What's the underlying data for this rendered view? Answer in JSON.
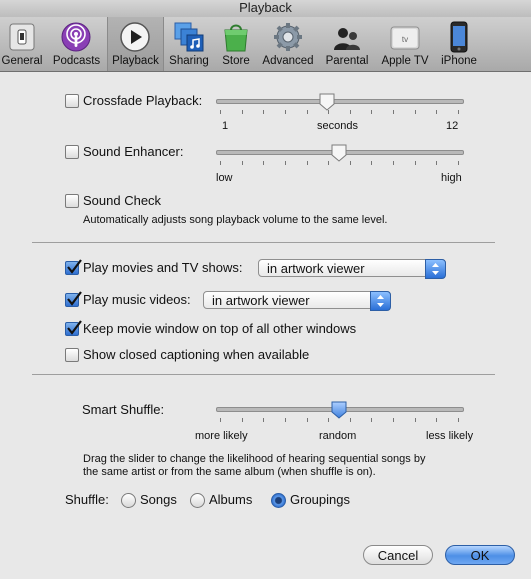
{
  "window": {
    "title": "Playback"
  },
  "toolbar": {
    "items": [
      {
        "label": "General",
        "icon": "general-switch-icon"
      },
      {
        "label": "Podcasts",
        "icon": "podcast-icon"
      },
      {
        "label": "Playback",
        "icon": "play-icon",
        "selected": true
      },
      {
        "label": "Sharing",
        "icon": "sharing-icon"
      },
      {
        "label": "Store",
        "icon": "store-bag-icon"
      },
      {
        "label": "Advanced",
        "icon": "gear-icon"
      },
      {
        "label": "Parental",
        "icon": "parental-icon"
      },
      {
        "label": "Apple TV",
        "icon": "apple-tv-icon"
      },
      {
        "label": "iPhone",
        "icon": "iphone-icon"
      }
    ]
  },
  "crossfade": {
    "label": "Crossfade Playback:",
    "checked": false,
    "min_label": "1",
    "unit_label": "seconds",
    "max_label": "12",
    "value_fraction": 0.45
  },
  "enhancer": {
    "label": "Sound Enhancer:",
    "checked": false,
    "min_label": "low",
    "max_label": "high",
    "value_fraction": 0.5
  },
  "sound_check": {
    "label": "Sound Check",
    "checked": false,
    "description": "Automatically adjusts song playback volume to the same level."
  },
  "video": {
    "movies_label": "Play movies and TV shows:",
    "movies_checked": true,
    "movies_select": "in artwork viewer",
    "music_label": "Play music videos:",
    "music_checked": true,
    "music_select": "in artwork viewer",
    "keep_on_top_label": "Keep movie window on top of all other windows",
    "keep_on_top_checked": true,
    "captions_label": "Show closed captioning when available",
    "captions_checked": false
  },
  "smart_shuffle": {
    "label": "Smart Shuffle:",
    "left_label": "more likely",
    "mid_label": "random",
    "right_label": "less likely",
    "value_fraction": 0.5,
    "description_line1": "Drag the slider to change the likelihood of hearing sequential songs by",
    "description_line2": "the same artist or from the same album (when shuffle is on)."
  },
  "shuffle": {
    "label": "Shuffle:",
    "options": [
      {
        "label": "Songs",
        "selected": false
      },
      {
        "label": "Albums",
        "selected": false
      },
      {
        "label": "Groupings",
        "selected": true
      }
    ]
  },
  "buttons": {
    "cancel": "Cancel",
    "ok": "OK"
  }
}
